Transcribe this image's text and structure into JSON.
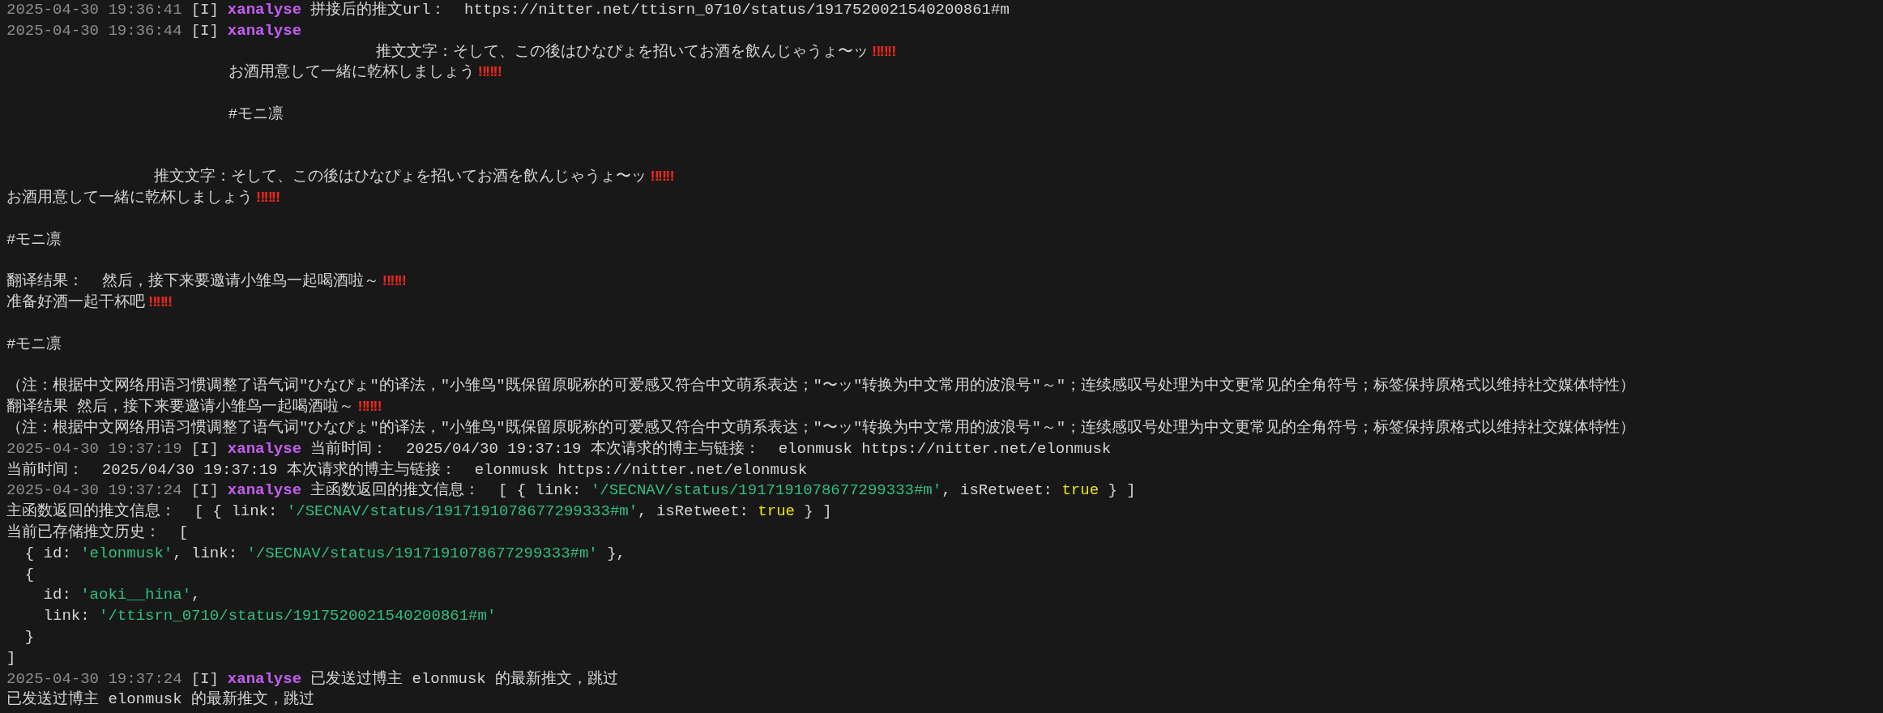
{
  "terminal": {
    "lines": [
      {
        "kind": "text",
        "segments": [
          {
            "kind": "timestamp",
            "text": "2025-04-30 19:36:41"
          },
          {
            "kind": "level",
            "text": "[I]"
          },
          {
            "kind": "logger",
            "text": "xanalyse"
          },
          {
            "kind": "plain",
            "text": "拼接后的推文url：  https://nitter.net/ttisrn_0710/status/1917520021540200861#m"
          }
        ]
      },
      {
        "kind": "text",
        "segments": [
          {
            "kind": "timestamp",
            "text": "2025-04-30 19:36:44"
          },
          {
            "kind": "level",
            "text": "[I]"
          },
          {
            "kind": "logger",
            "text": "xanalyse"
          }
        ]
      },
      {
        "kind": "text",
        "segments": [
          {
            "kind": "plain",
            "text": "                                        推文文字：そして、この後はひなぴょを招いてお酒を飲んじゃうょ〜ッ"
          },
          {
            "kind": "emoji",
            "text": "‼‼‼"
          }
        ]
      },
      {
        "kind": "text",
        "segments": [
          {
            "kind": "plain",
            "text": "                        お酒用意して一緒に乾杯しましょう"
          },
          {
            "kind": "emoji",
            "text": "‼‼‼"
          }
        ]
      },
      {
        "kind": "blank"
      },
      {
        "kind": "text",
        "segments": [
          {
            "kind": "plain",
            "text": "                        #モニ凛"
          }
        ]
      },
      {
        "kind": "blank"
      },
      {
        "kind": "blank"
      },
      {
        "kind": "text",
        "segments": [
          {
            "kind": "plain",
            "text": "                推文文字：そして、この後はひなぴょを招いてお酒を飲んじゃうょ〜ッ"
          },
          {
            "kind": "emoji",
            "text": "‼‼‼"
          }
        ]
      },
      {
        "kind": "text",
        "segments": [
          {
            "kind": "plain",
            "text": "お酒用意して一緒に乾杯しましょう"
          },
          {
            "kind": "emoji",
            "text": "‼‼‼"
          }
        ]
      },
      {
        "kind": "blank"
      },
      {
        "kind": "text",
        "segments": [
          {
            "kind": "plain",
            "text": "#モニ凛"
          }
        ]
      },
      {
        "kind": "blank"
      },
      {
        "kind": "text",
        "segments": [
          {
            "kind": "plain",
            "text": "翻译结果：  然后，接下来要邀请小雏鸟一起喝酒啦～"
          },
          {
            "kind": "emoji",
            "text": "‼‼‼"
          }
        ]
      },
      {
        "kind": "text",
        "segments": [
          {
            "kind": "plain",
            "text": "准备好酒一起干杯吧"
          },
          {
            "kind": "emoji",
            "text": "‼‼‼"
          }
        ]
      },
      {
        "kind": "blank"
      },
      {
        "kind": "text",
        "segments": [
          {
            "kind": "plain",
            "text": "#モニ凛"
          }
        ]
      },
      {
        "kind": "blank"
      },
      {
        "kind": "text",
        "segments": [
          {
            "kind": "plain",
            "text": "（注：根据中文网络用语习惯调整了语气词\"ひなぴょ\"的译法，\"小雏鸟\"既保留原昵称的可爱感又符合中文萌系表达；\"〜ッ\"转换为中文常用的波浪号\"～\"；连续感叹号处理为中文更常见的全角符号；标签保持原格式以维持社交媒体特性）"
          }
        ]
      },
      {
        "kind": "text",
        "segments": [
          {
            "kind": "plain",
            "text": "翻译结果 然后，接下来要邀请小雏鸟一起喝酒啦～"
          },
          {
            "kind": "emoji",
            "text": "‼‼‼"
          }
        ]
      },
      {
        "kind": "text",
        "segments": [
          {
            "kind": "plain",
            "text": "（注：根据中文网络用语习惯调整了语气词\"ひなぴょ\"的译法，\"小雏鸟\"既保留原昵称的可爱感又符合中文萌系表达；\"〜ッ\"转换为中文常用的波浪号\"～\"；连续感叹号处理为中文更常见的全角符号；标签保持原格式以维持社交媒体特性）"
          }
        ]
      },
      {
        "kind": "text",
        "segments": [
          {
            "kind": "timestamp",
            "text": "2025-04-30 19:37:19"
          },
          {
            "kind": "level",
            "text": "[I]"
          },
          {
            "kind": "logger",
            "text": "xanalyse"
          },
          {
            "kind": "plain",
            "text": "当前时间：  2025/04/30 19:37:19 本次请求的博主与链接：  elonmusk https://nitter.net/elonmusk"
          }
        ]
      },
      {
        "kind": "text",
        "segments": [
          {
            "kind": "plain",
            "text": "当前时间：  2025/04/30 19:37:19 本次请求的博主与链接：  elonmusk https://nitter.net/elonmusk"
          }
        ]
      },
      {
        "kind": "text",
        "segments": [
          {
            "kind": "timestamp",
            "text": "2025-04-30 19:37:24"
          },
          {
            "kind": "level",
            "text": "[I]"
          },
          {
            "kind": "logger",
            "text": "xanalyse"
          },
          {
            "kind": "plain",
            "text": "主函数返回的推文信息：  [ { link: "
          },
          {
            "kind": "string",
            "text": "'/SECNAV/status/1917191078677299333#m'"
          },
          {
            "kind": "plain",
            "text": ", isRetweet: "
          },
          {
            "kind": "boolean",
            "text": "true"
          },
          {
            "kind": "plain",
            "text": " } ]"
          }
        ]
      },
      {
        "kind": "text",
        "segments": [
          {
            "kind": "plain",
            "text": "主函数返回的推文信息：  [ { link: "
          },
          {
            "kind": "string",
            "text": "'/SECNAV/status/1917191078677299333#m'"
          },
          {
            "kind": "plain",
            "text": ", isRetweet: "
          },
          {
            "kind": "boolean",
            "text": "true"
          },
          {
            "kind": "plain",
            "text": " } ]"
          }
        ]
      },
      {
        "kind": "text",
        "segments": [
          {
            "kind": "plain",
            "text": "当前已存储推文历史：  ["
          }
        ]
      },
      {
        "kind": "text",
        "segments": [
          {
            "kind": "plain",
            "text": "  { id: "
          },
          {
            "kind": "string",
            "text": "'elonmusk'"
          },
          {
            "kind": "plain",
            "text": ", link: "
          },
          {
            "kind": "string",
            "text": "'/SECNAV/status/1917191078677299333#m'"
          },
          {
            "kind": "plain",
            "text": " },"
          }
        ]
      },
      {
        "kind": "text",
        "segments": [
          {
            "kind": "plain",
            "text": "  {"
          }
        ]
      },
      {
        "kind": "text",
        "segments": [
          {
            "kind": "plain",
            "text": "    id: "
          },
          {
            "kind": "string",
            "text": "'aoki__hina'"
          },
          {
            "kind": "plain",
            "text": ","
          }
        ]
      },
      {
        "kind": "text",
        "segments": [
          {
            "kind": "plain",
            "text": "    link: "
          },
          {
            "kind": "string",
            "text": "'/ttisrn_0710/status/1917520021540200861#m'"
          }
        ]
      },
      {
        "kind": "text",
        "segments": [
          {
            "kind": "plain",
            "text": "  }"
          }
        ]
      },
      {
        "kind": "text",
        "segments": [
          {
            "kind": "plain",
            "text": "]"
          }
        ]
      },
      {
        "kind": "text",
        "segments": [
          {
            "kind": "timestamp",
            "text": "2025-04-30 19:37:24"
          },
          {
            "kind": "level",
            "text": "[I]"
          },
          {
            "kind": "logger",
            "text": "xanalyse"
          },
          {
            "kind": "plain",
            "text": "已发送过博主 elonmusk 的最新推文，跳过"
          }
        ]
      },
      {
        "kind": "text",
        "segments": [
          {
            "kind": "plain",
            "text": "已发送过博主 elonmusk 的最新推文，跳过"
          }
        ]
      }
    ]
  }
}
